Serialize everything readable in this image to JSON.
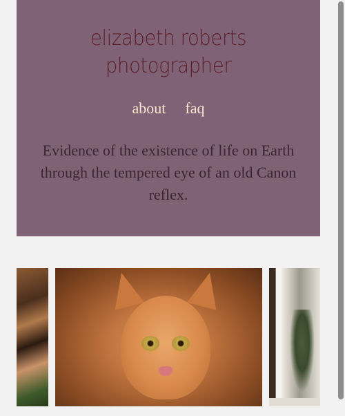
{
  "site": {
    "title_line1": "elizabeth roberts",
    "title_line2": "photographer"
  },
  "nav": {
    "items": [
      {
        "label": "about"
      },
      {
        "label": "faq"
      }
    ]
  },
  "tagline": "Evidence of the existence of life on Earth through the tempered eye of an old Canon reflex.",
  "colors": {
    "header_bg": "#7f6275",
    "title": "#5a1f2a",
    "nav_link": "#fde8d2",
    "tagline": "#3b2530",
    "page_bg": "#f2f2f2"
  },
  "gallery": {
    "photos": [
      {
        "subject": "autumn-leaves-photo"
      },
      {
        "subject": "orange-cat-photo"
      },
      {
        "subject": "window-plant-photo"
      }
    ]
  }
}
